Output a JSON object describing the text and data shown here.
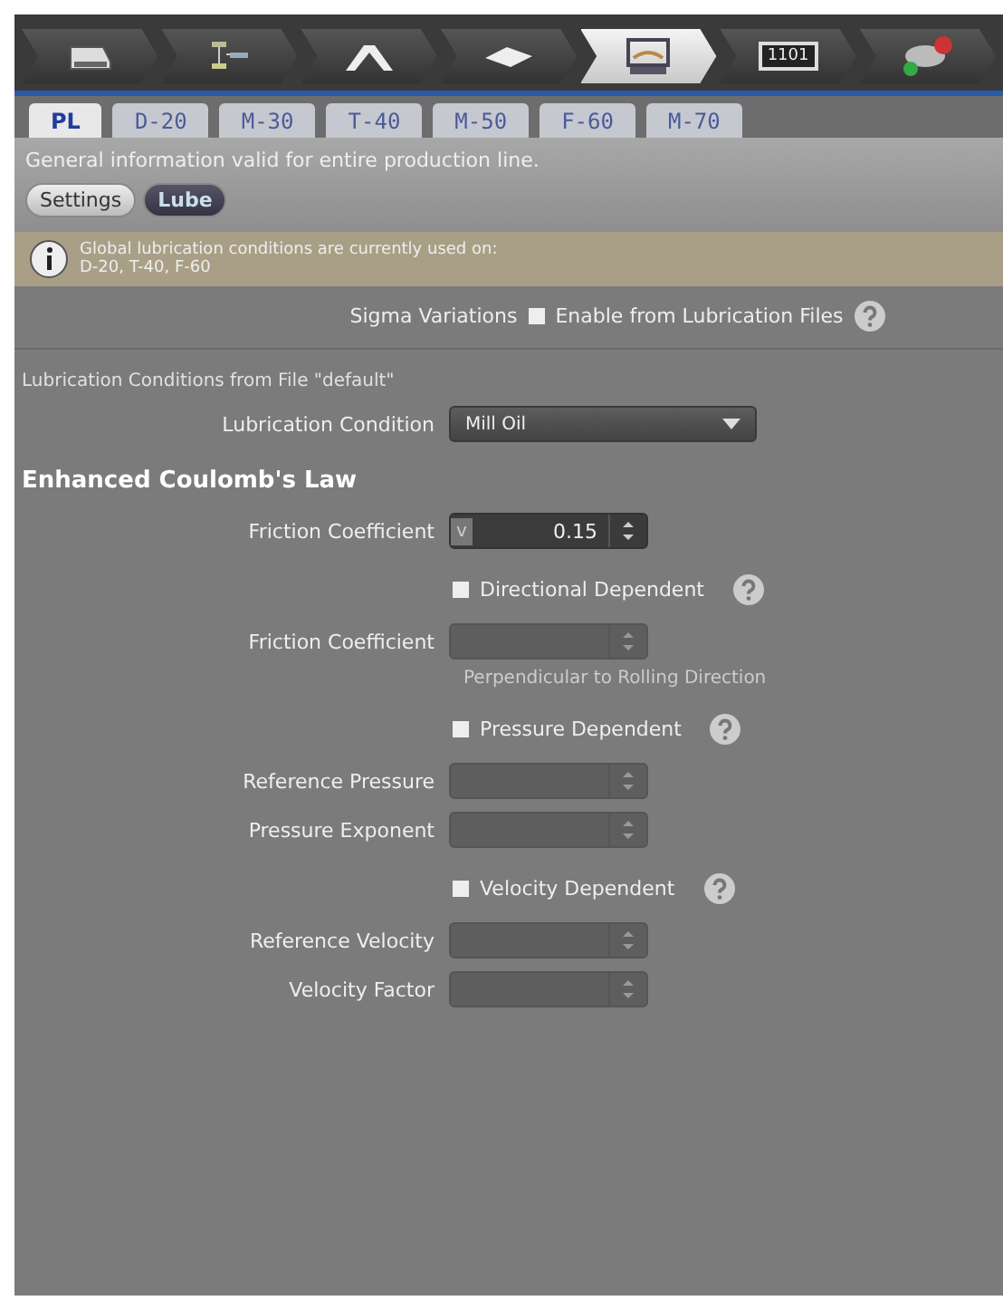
{
  "workflow": [
    {
      "kind": "sheet",
      "selected": false
    },
    {
      "kind": "flow",
      "selected": false
    },
    {
      "kind": "profile",
      "selected": false
    },
    {
      "kind": "plate",
      "selected": false
    },
    {
      "kind": "mill",
      "selected": true
    },
    {
      "kind": "monitor",
      "selected": false
    },
    {
      "kind": "status",
      "selected": false
    }
  ],
  "workflow_monitor_label": "1101",
  "tabs": [
    {
      "label": "PL",
      "selected": true
    },
    {
      "label": "D-20",
      "selected": false
    },
    {
      "label": "M-30",
      "selected": false
    },
    {
      "label": "T-40",
      "selected": false
    },
    {
      "label": "M-50",
      "selected": false
    },
    {
      "label": "F-60",
      "selected": false
    },
    {
      "label": "M-70",
      "selected": false
    }
  ],
  "description": "General information valid for entire production line.",
  "subtabs": [
    {
      "label": "Settings",
      "selected": false
    },
    {
      "label": "Lube",
      "selected": true
    }
  ],
  "info": {
    "lines": [
      "Global lubrication conditions are currently used on:",
      "D-20, T-40, F-60"
    ]
  },
  "sigma": {
    "label": "Sigma Variations",
    "option": "Enable from Lubrication Files",
    "checked": false
  },
  "file_caption": "Lubrication Conditions from File \"default\"",
  "lubrication": {
    "label": "Lubrication Condition",
    "value": "Mill Oil"
  },
  "heading": "Enhanced Coulomb's Law",
  "friction": {
    "label": "Friction Coefficient",
    "value": "0.15",
    "toggle": "v"
  },
  "groups": [
    {
      "title": "Directional Dependent",
      "checked": false,
      "fields": [
        {
          "label": "Friction Coefficient",
          "disabled": true
        }
      ],
      "hint": "Perpendicular to Rolling Direction"
    },
    {
      "title": "Pressure Dependent",
      "checked": false,
      "fields": [
        {
          "label": "Reference Pressure",
          "disabled": true
        },
        {
          "label": "Pressure Exponent",
          "disabled": true
        }
      ]
    },
    {
      "title": "Velocity Dependent",
      "checked": false,
      "fields": [
        {
          "label": "Reference Velocity",
          "disabled": true
        },
        {
          "label": "Velocity Factor",
          "disabled": true
        }
      ]
    }
  ]
}
